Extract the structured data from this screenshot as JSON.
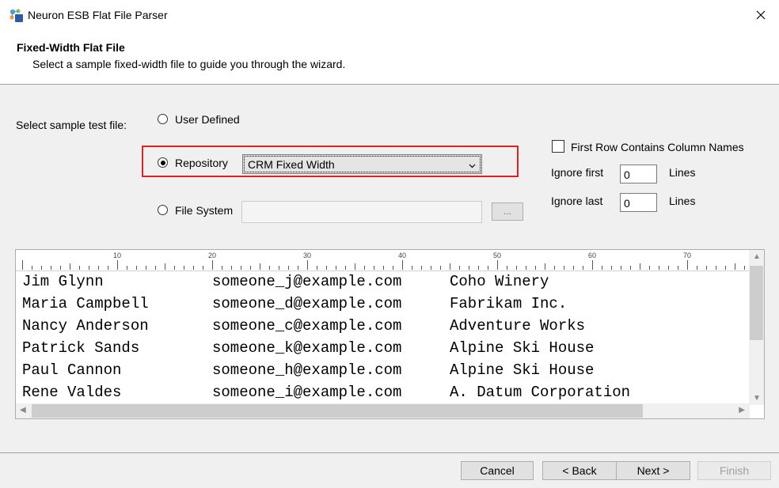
{
  "window": {
    "title": "Neuron ESB Flat File Parser"
  },
  "header": {
    "title": "Fixed-Width Flat File",
    "subtitle": "Select a sample fixed-width file to guide you through the wizard."
  },
  "form": {
    "sample_label": "Select sample test file:",
    "options": {
      "user_defined": "User Defined",
      "repository": "Repository",
      "file_system": "File System"
    },
    "selected_option": "repository",
    "repository_value": "CRM Fixed Width",
    "file_system_value": "",
    "browse_label": "...",
    "first_row_label": "First Row Contains Column Names",
    "ignore_first_label": "Ignore first",
    "ignore_first_value": "0",
    "ignore_last_label": "Ignore last",
    "ignore_last_value": "0",
    "lines_label": "Lines"
  },
  "preview": {
    "ruler_labels": [
      "10",
      "20",
      "30",
      "40",
      "50",
      "60",
      "70"
    ],
    "rows": [
      [
        "Jim Glynn",
        "someone_j@example.com",
        "Coho Winery"
      ],
      [
        "Maria Campbell",
        "someone_d@example.com",
        "Fabrikam Inc."
      ],
      [
        "Nancy Anderson",
        "someone_c@example.com",
        "Adventure Works"
      ],
      [
        "Patrick Sands",
        "someone_k@example.com",
        "Alpine Ski House"
      ],
      [
        "Paul Cannon",
        "someone_h@example.com",
        "Alpine Ski House"
      ],
      [
        "Rene Valdes",
        "someone_i@example.com",
        "A. Datum Corporation"
      ]
    ]
  },
  "footer": {
    "cancel": "Cancel",
    "back": "< Back",
    "next": "Next >",
    "finish": "Finish"
  },
  "colors": {
    "highlight": "#e02020",
    "background": "#f0f0f0"
  }
}
